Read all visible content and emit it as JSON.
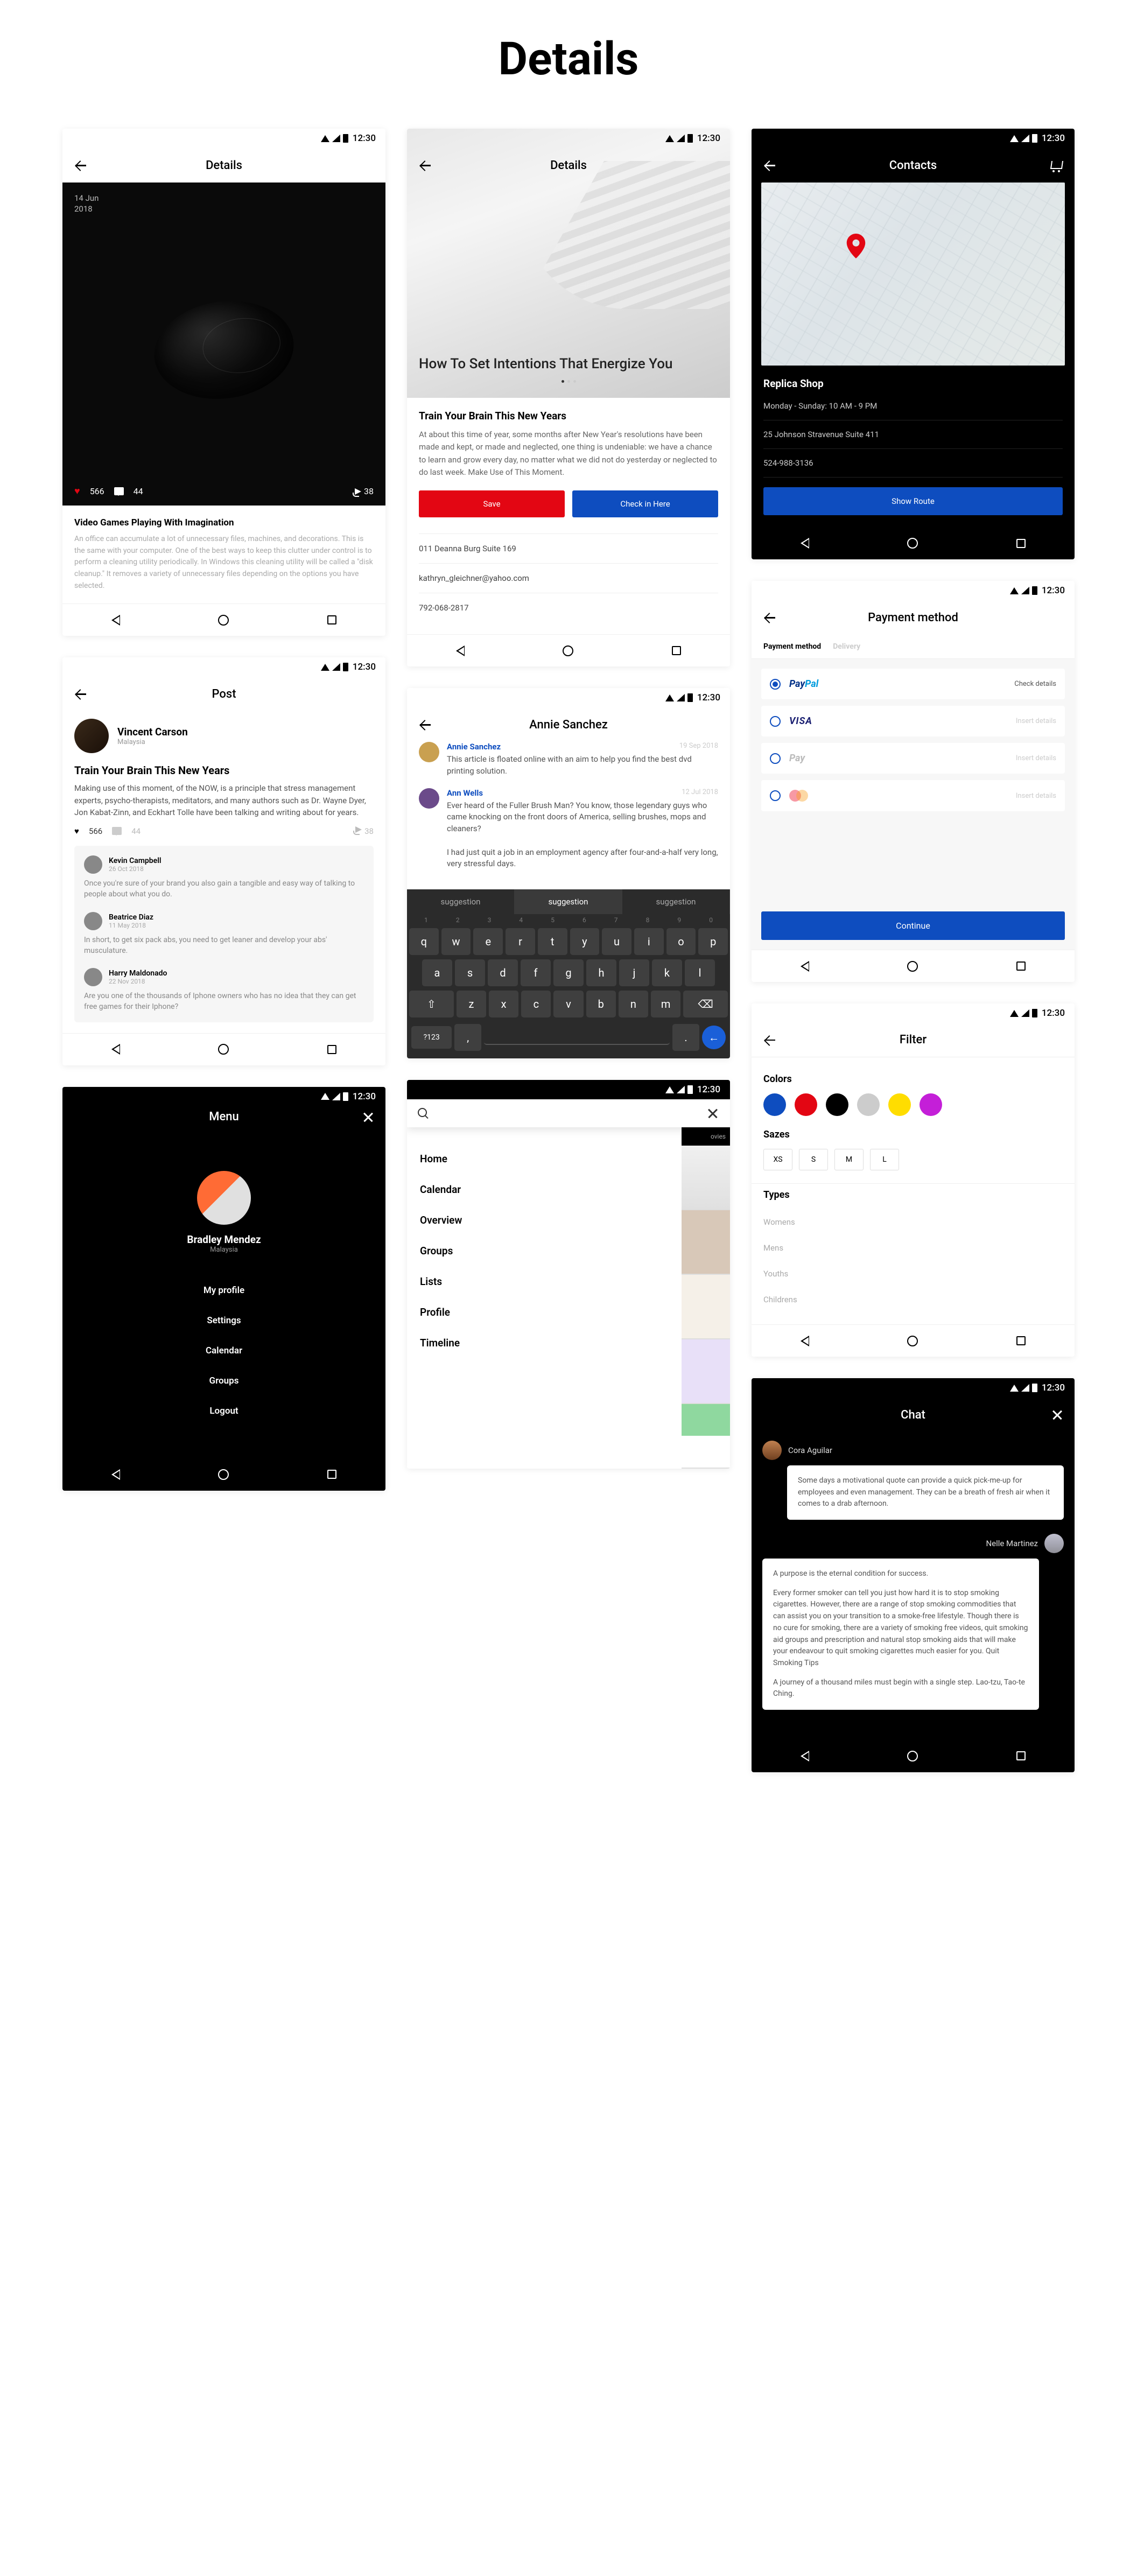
{
  "page_title": "Details",
  "status_time": "12:30",
  "s1": {
    "title": "Details",
    "date_day": "14 Jun",
    "date_year": "2018",
    "likes": "566",
    "comments": "44",
    "shares": "38",
    "headline": "Video Games Playing With Imagination",
    "body": "An office can accumulate a lot of unnecessary files, machines, and decorations. This is the same with your computer. One of the best ways to keep this clutter under control is to perform a cleaning utility periodically. In Windows this cleaning utility will be called a \"disk cleanup.\" It removes a variety of unnecessary files depending on the options you have selected."
  },
  "s2": {
    "title": "Post",
    "user_name": "Vincent Carson",
    "user_loc": "Malaysia",
    "headline": "Train Your Brain This New Years",
    "body": "Making use of this moment, of the NOW, is a principle that stress management experts, psycho-therapists, meditators, and many authors such as Dr. Wayne Dyer, Jon Kabat-Zinn, and Eckhart Tolle have been talking and writing about for years.",
    "likes": "566",
    "comment_count": "44",
    "shares": "38",
    "comments": [
      {
        "name": "Kevin Campbell",
        "date": "26 Oct 2018",
        "text": "Once you're sure of your brand you also gain a tangible and easy way of talking to people about what you do."
      },
      {
        "name": "Beatrice Diaz",
        "date": "11 May 2018",
        "text": "In short, to get six pack abs, you need to get leaner and develop your abs' musculature."
      },
      {
        "name": "Harry Maldonado",
        "date": "22 Nov 2018",
        "text": "Are you one of the thousands of Iphone owners who has no idea that they can get free games for their Iphone?"
      }
    ]
  },
  "s3": {
    "title": "Menu",
    "user_name": "Bradley Mendez",
    "user_loc": "Malaysia",
    "items": [
      "My profile",
      "Settings",
      "Calendar",
      "Groups",
      "Logout"
    ]
  },
  "s4": {
    "title": "Details",
    "hero_title": "How To Set Intentions That Energize You",
    "headline": "Train Your Brain This New Years",
    "body": "At about this time of year, some months after New Year's resolutions have been made and kept, or made and neglected, one thing is undeniable: we have a chance to learn and grow every day, no matter what we did not do yesterday or neglected to do last week.  Make Use of This Moment.",
    "btn_save": "Save",
    "btn_checkin": "Check in Here",
    "address": "011 Deanna Burg Suite 169",
    "email": "kathryn_gleichner@yahoo.com",
    "phone": "792-068-2817"
  },
  "s5": {
    "title": "Annie Sanchez",
    "c1_name": "Annie Sanchez",
    "c1_date": "19 Sep 2018",
    "c1_text": "This article is floated online with an aim to help you find the best dvd printing solution.",
    "c2_name": "Ann Wells",
    "c2_date": "12 Jul 2018",
    "c2_text1": "Ever heard of the Fuller Brush Man? You know, those legendary guys who came knocking on the front doors of America, selling brushes, mops and cleaners?",
    "c2_text2": "I had just quit a job in an employment agency after four-and-a-half very long, very stressful days.",
    "suggestion": "suggestion",
    "key_sym": "?123"
  },
  "s6": {
    "side_label": "ovies",
    "items": [
      "Home",
      "Calendar",
      "Overview",
      "Groups",
      "Lists",
      "Profile",
      "Timeline"
    ]
  },
  "s7": {
    "title": "Contacts",
    "shop_name": "Replica Shop",
    "hours": "Monday - Sunday: 10 AM - 9 PM",
    "address": "25 Johnson Stravenue Suite 411",
    "phone": "524-988-3136",
    "btn": "Show Route"
  },
  "s8": {
    "title": "Payment method",
    "tab1": "Payment method",
    "tab2": "Delivery",
    "check": "Check details",
    "insert": "Insert details",
    "btn": "Continue"
  },
  "s9": {
    "title": "Filter",
    "h_colors": "Colors",
    "h_sizes": "Sazes",
    "h_types": "Types",
    "colors": [
      "#0E4DBF",
      "#E30613",
      "#000000",
      "#cccccc",
      "#FFDD00",
      "#C41FD8"
    ],
    "sizes": [
      "XS",
      "S",
      "M",
      "L"
    ],
    "types": [
      "Womens",
      "Mens",
      "Youths",
      "Childrens"
    ]
  },
  "s10": {
    "title": "Chat",
    "u1": "Cora Aguilar",
    "m1": "Some days a motivational quote can provide a quick pick-me-up for employees and even management. They can be a breath of fresh air when it comes to a drab afternoon.",
    "u2": "Nelle Martinez",
    "m2a": "A purpose is the eternal condition for success.",
    "m2b": "Every former smoker can tell you just how hard it is to stop smoking cigarettes. However, there are a range of stop smoking commodities that can assist you on your transition to a smoke-free lifestyle. Though there is no cure for smoking, there are a variety of smoking free videos, quit smoking aid groups and prescription and natural stop smoking aids that will make your endeavour to quit smoking cigarettes much easier for you. Quit Smoking Tips",
    "m2c": "A journey of a thousand miles must begin with a single step. Lao-tzu, Tao-te Ching."
  }
}
